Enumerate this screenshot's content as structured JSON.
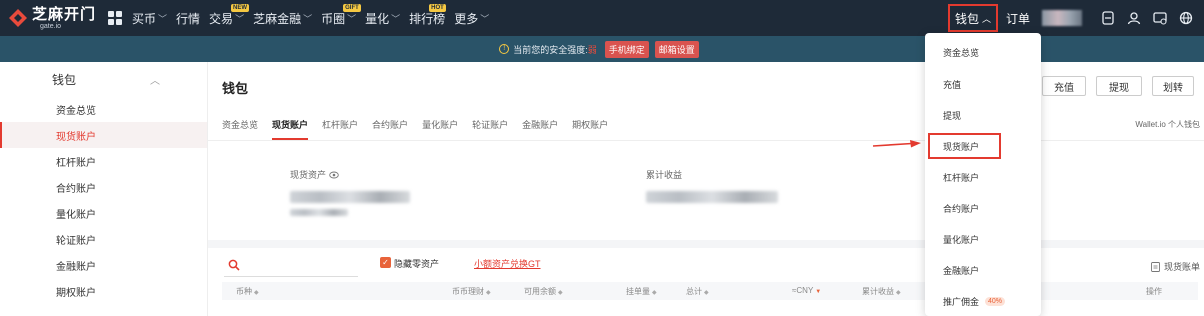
{
  "nav": {
    "logo_text": "芝麻开门",
    "logo_sub": "gate.io",
    "items": [
      {
        "label": "买币",
        "chevron": true
      },
      {
        "label": "行情",
        "chevron": false
      },
      {
        "label": "交易",
        "chevron": true,
        "badge": "NEW"
      },
      {
        "label": "芝麻金融",
        "chevron": true
      },
      {
        "label": "币圈",
        "chevron": false,
        "badge": "GIFT"
      },
      {
        "label": "量化",
        "chevron": true
      },
      {
        "label": "排行榜",
        "chevron": false,
        "badge": "HOT"
      },
      {
        "label": "更多",
        "chevron": true
      }
    ],
    "wallet_label": "钱包",
    "order_label": "订单",
    "right_icons": [
      "download-icon",
      "user-icon",
      "message-icon",
      "globe-icon"
    ]
  },
  "notice": {
    "text": "当前您的安全强度:",
    "level": "弱",
    "buttons": [
      "手机绑定",
      "邮箱设置"
    ]
  },
  "sidebar": {
    "header": "钱包",
    "items": [
      {
        "label": "资金总览",
        "active": false
      },
      {
        "label": "现货账户",
        "active": true
      },
      {
        "label": "杠杆账户",
        "active": false
      },
      {
        "label": "合约账户",
        "active": false
      },
      {
        "label": "量化账户",
        "active": false
      },
      {
        "label": "轮证账户",
        "active": false
      },
      {
        "label": "金融账户",
        "active": false
      },
      {
        "label": "期权账户",
        "active": false
      }
    ]
  },
  "main": {
    "title": "钱包",
    "buttons": [
      "充值",
      "提现",
      "划转"
    ],
    "tabs": [
      "资金总览",
      "现货账户",
      "杠杆账户",
      "合约账户",
      "量化账户",
      "轮证账户",
      "金融账户",
      "期权账户"
    ],
    "active_tab": "现货账户",
    "wallet_link": "Wallet.io 个人钱包",
    "spot_assets_label": "现货资产",
    "cumulative_label": "累计收益",
    "hide_zero_label": "隐藏零资产",
    "small_convert_link": "小额资产兑换GT",
    "records_link": "现货账单",
    "columns": [
      "币种",
      "币币理财",
      "可用余额",
      "挂单量",
      "总计",
      "≈CNY",
      "累计收益",
      "操作"
    ]
  },
  "dropdown": {
    "items": [
      "资金总览",
      "充值",
      "提现",
      "现货账户",
      "杠杆账户",
      "合约账户",
      "量化账户",
      "金融账户",
      "推广佣金"
    ],
    "highlighted": "现货账户",
    "commission_badge": "40%"
  },
  "colors": {
    "topbar": "#1e2a38",
    "notice_bar": "#2a5368",
    "accent": "#e33a2f",
    "orange": "#e8633a"
  }
}
